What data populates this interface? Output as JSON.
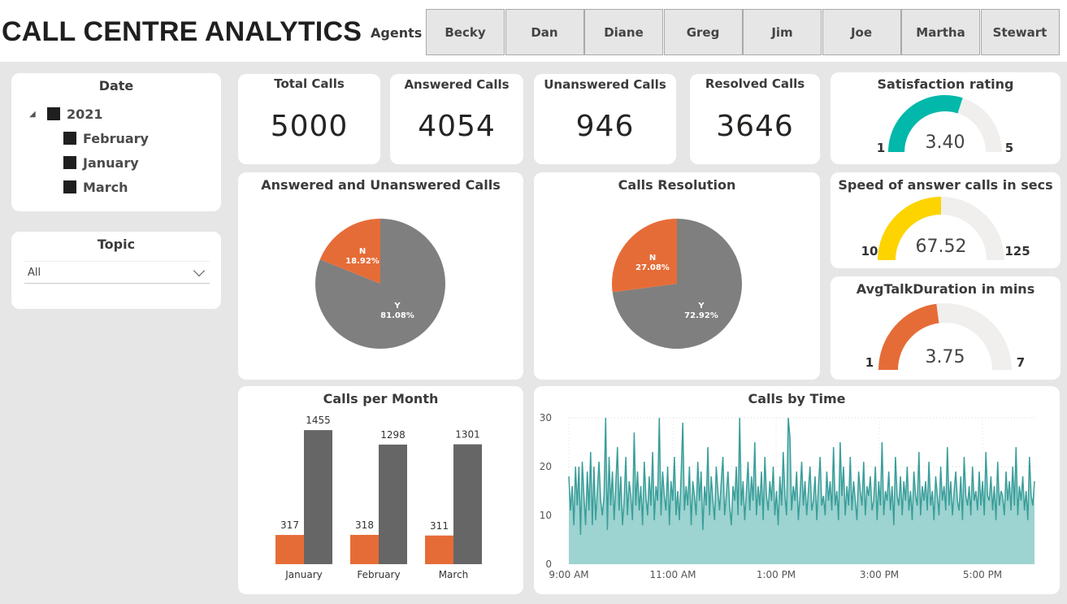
{
  "header": {
    "title": "CALL CENTRE ANALYTICS",
    "agents_label": "Agents",
    "agents": [
      "Becky",
      "Dan",
      "Diane",
      "Greg",
      "Jim",
      "Joe",
      "Martha",
      "Stewart"
    ]
  },
  "date_slicer": {
    "title": "Date",
    "year": "2021",
    "months": [
      "February",
      "January",
      "March"
    ]
  },
  "topic_slicer": {
    "title": "Topic",
    "selected": "All"
  },
  "kpis": {
    "total_calls": {
      "label": "Total Calls",
      "value": "5000"
    },
    "answered_calls": {
      "label": "Answered Calls",
      "value": "4054"
    },
    "unanswered_calls": {
      "label": "Unanswered Calls",
      "value": "946"
    },
    "resolved_calls": {
      "label": "Resolved Calls",
      "value": "3646"
    }
  },
  "gauges": {
    "satisfaction": {
      "title": "Satisfaction rating",
      "min": 1,
      "max": 5,
      "value": 3.4,
      "display": "3.40",
      "min_label": "1",
      "max_label": "5",
      "color": "#01b8aa"
    },
    "speed": {
      "title": "Speed of answer calls in secs",
      "min": 10,
      "max": 125,
      "value": 67.52,
      "display": "67.52",
      "min_label": "10",
      "max_label": "125",
      "color": "#fdd400"
    },
    "talk": {
      "title": "AvgTalkDuration in mins",
      "min": 1,
      "max": 7,
      "value": 3.75,
      "display": "3.75",
      "min_label": "1",
      "max_label": "7",
      "color": "#e66c37"
    }
  },
  "colors": {
    "orange": "#e66c37",
    "gray": "#7f7f7f",
    "dark_gray": "#666666",
    "teal_line": "#3a9e9a",
    "teal_fill": "#9dd3d0",
    "gauge_track": "#f0efed"
  },
  "chart_data": [
    {
      "type": "pie",
      "title": "Answered and Unanswered Calls",
      "slices": [
        {
          "name": "Y",
          "value": 81.08,
          "label": "81.08%"
        },
        {
          "name": "N",
          "value": 18.92,
          "label": "18.92%"
        }
      ]
    },
    {
      "type": "pie",
      "title": "Calls Resolution",
      "slices": [
        {
          "name": "Y",
          "value": 72.92,
          "label": "72.92%"
        },
        {
          "name": "N",
          "value": 27.08,
          "label": "27.08%"
        }
      ]
    },
    {
      "type": "bar",
      "title": "Calls per Month",
      "categories": [
        "January",
        "February",
        "March"
      ],
      "series": [
        {
          "values": [
            317,
            318,
            311
          ]
        },
        {
          "values": [
            1455,
            1298,
            1301
          ]
        }
      ],
      "ylim": [
        0,
        1500
      ]
    },
    {
      "type": "area",
      "title": "Calls by Time",
      "x_ticks": [
        "9:00 AM",
        "11:00 AM",
        "1:00 PM",
        "3:00 PM",
        "5:00 PM"
      ],
      "y_ticks": [
        0,
        10,
        20,
        30
      ],
      "ylim": [
        0,
        30
      ],
      "grid": true,
      "values": [
        18,
        11,
        16,
        8,
        20,
        12,
        20,
        6,
        21,
        14,
        8,
        19,
        11,
        23,
        8,
        20,
        9,
        15,
        21,
        13,
        10,
        14,
        25,
        7,
        22,
        12,
        19,
        9,
        16,
        24,
        11,
        18,
        8,
        13,
        22,
        10,
        17,
        14,
        9,
        27,
        12,
        19,
        11,
        16,
        8,
        21,
        14,
        10,
        18,
        12,
        23,
        9,
        16,
        13,
        28,
        10,
        19,
        14,
        11,
        20,
        8,
        17,
        13,
        22,
        10,
        15,
        9,
        18,
        26,
        11,
        16,
        12,
        20,
        8,
        17,
        14,
        10,
        21,
        13,
        19,
        7,
        16,
        12,
        24,
        10,
        18,
        13,
        9,
        20,
        15,
        11,
        17,
        22,
        10,
        14,
        19,
        12,
        8,
        16,
        13,
        20,
        10,
        24,
        12,
        17,
        9,
        15,
        21,
        11,
        18,
        13,
        25,
        10,
        16,
        12,
        19,
        9,
        22,
        14,
        11,
        17,
        13,
        20,
        10,
        15,
        8,
        18,
        12,
        23,
        14,
        10,
        17,
        26,
        11,
        16,
        13,
        19,
        9,
        14,
        21,
        12,
        17,
        10,
        15,
        20,
        11,
        13,
        18,
        9,
        16,
        22,
        12,
        14,
        10,
        19,
        13,
        17,
        11,
        24,
        12,
        15,
        9,
        18,
        14,
        20,
        10,
        16,
        12,
        22,
        11,
        17,
        13,
        9,
        19,
        15,
        12,
        21,
        10,
        16,
        14,
        18,
        11,
        13,
        20,
        9,
        17,
        12,
        25,
        10,
        15,
        13,
        19,
        11,
        16,
        8,
        22,
        14,
        12,
        18,
        10,
        17,
        13,
        20,
        11,
        15,
        9,
        19,
        14,
        12,
        23,
        10,
        16,
        13,
        17,
        11,
        21,
        12,
        15,
        9,
        18,
        14,
        10,
        20,
        13,
        16,
        11,
        24,
        12,
        17,
        10,
        15,
        19,
        13,
        11,
        18,
        9,
        22,
        14,
        12,
        16,
        10,
        20,
        13,
        15,
        11,
        19,
        12,
        17,
        10,
        23,
        14,
        13,
        18,
        11,
        16,
        9,
        21,
        12,
        15,
        14,
        10,
        19,
        13,
        17,
        11,
        20,
        12,
        24,
        10,
        16,
        13,
        18,
        11,
        15,
        9,
        22,
        14,
        12,
        17
      ],
      "peaks": {
        "22": 30,
        "54": 30,
        "68": 29,
        "102": 30,
        "131": 30,
        "162": 25
      }
    }
  ]
}
